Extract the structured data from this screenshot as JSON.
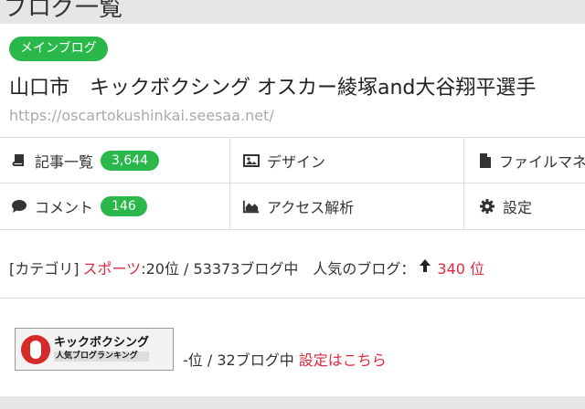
{
  "header": {
    "title": "ブログ一覧"
  },
  "blog": {
    "badge": "メインブログ",
    "title": "山口市　キックボクシング オスカー綾塚and大谷翔平選手",
    "url": "https://oscartokushinkai.seesaa.net/"
  },
  "menu": {
    "articles": {
      "label": "記事一覧",
      "count": "3,644",
      "icon": "book-icon"
    },
    "design": {
      "label": "デザイン",
      "icon": "image-icon"
    },
    "files": {
      "label": "ファイルマネージャー",
      "icon": "file-icon"
    },
    "comments": {
      "label": "コメント",
      "count": "146",
      "icon": "comment-icon"
    },
    "analytics": {
      "label": "アクセス解析",
      "icon": "chart-area-icon"
    },
    "settings": {
      "label": "設定",
      "icon": "gear-icon"
    }
  },
  "ranking": {
    "category_prefix": "[カテゴリ]",
    "category": "スポーツ",
    "rank_text": ":20位 / 53373ブログ中　人気のブログ：",
    "popular_rank": "340 位"
  },
  "banner": {
    "title": "キックボクシング",
    "subtitle": "人気ブログランキング",
    "rank_text": "-位 / 32ブログ中",
    "settings_link": "設定はこちら"
  },
  "colors": {
    "accent_green": "#2ab84b",
    "link_red": "#e0293f"
  }
}
